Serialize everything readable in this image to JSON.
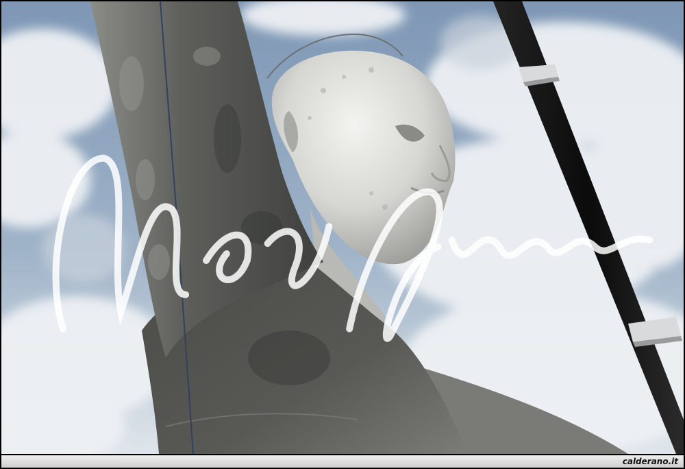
{
  "photo": {
    "subject": "statue-photo",
    "credit": "calderano.it",
    "colors": {
      "sky": "#8fa4bd",
      "cloud": "#e9edf1",
      "stone_light": "#d8d8d8",
      "stone_dark": "#3f3f3f",
      "pole": "#121212",
      "frame": "#000000"
    }
  }
}
